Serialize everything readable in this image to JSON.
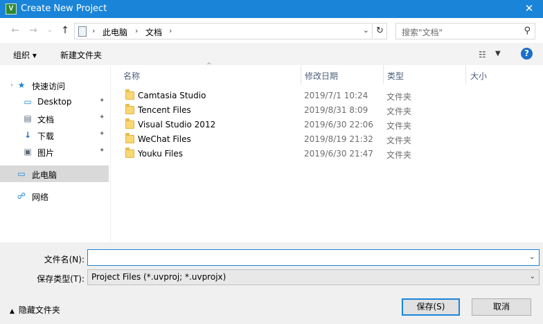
{
  "window": {
    "title": "Create New Project",
    "app_icon": "V",
    "close_label": "✕"
  },
  "address": {
    "crumbs": [
      "此电脑",
      "文档"
    ]
  },
  "search": {
    "placeholder": "搜索\"文档\""
  },
  "toolbar": {
    "organize_label": "组织 ▾",
    "new_folder_label": "新建文件夹",
    "help_label": "?"
  },
  "nav": {
    "quick_access": "快速访问",
    "items": [
      {
        "label": "Desktop",
        "icon": "desktop-icon"
      },
      {
        "label": "文档",
        "icon": "documents-icon"
      },
      {
        "label": "下载",
        "icon": "download-icon"
      },
      {
        "label": "图片",
        "icon": "pictures-icon"
      }
    ],
    "this_pc": "此电脑",
    "network": "网络"
  },
  "columns": {
    "name": "名称",
    "date": "修改日期",
    "type": "类型",
    "size": "大小"
  },
  "files": [
    {
      "name": "Camtasia Studio",
      "date": "2019/7/1 10:24",
      "type": "文件夹"
    },
    {
      "name": "Tencent Files",
      "date": "2019/8/31 8:09",
      "type": "文件夹"
    },
    {
      "name": "Visual Studio 2012",
      "date": "2019/6/30 22:06",
      "type": "文件夹"
    },
    {
      "name": "WeChat Files",
      "date": "2019/8/19 21:32",
      "type": "文件夹"
    },
    {
      "name": "Youku Files",
      "date": "2019/6/30 21:47",
      "type": "文件夹"
    }
  ],
  "form": {
    "filename_label": "文件名(N):",
    "filename_value": "",
    "filetype_label": "保存类型(T):",
    "filetype_value": "Project Files (*.uvproj; *.uvprojx)"
  },
  "footer": {
    "hide_folders_label": "隐藏文件夹",
    "save_label": "保存(S)",
    "cancel_label": "取消"
  },
  "colors": {
    "accent": "#1a84d8",
    "selected_bg": "#d9d9d9",
    "panel_bg": "#f0f0f0"
  }
}
